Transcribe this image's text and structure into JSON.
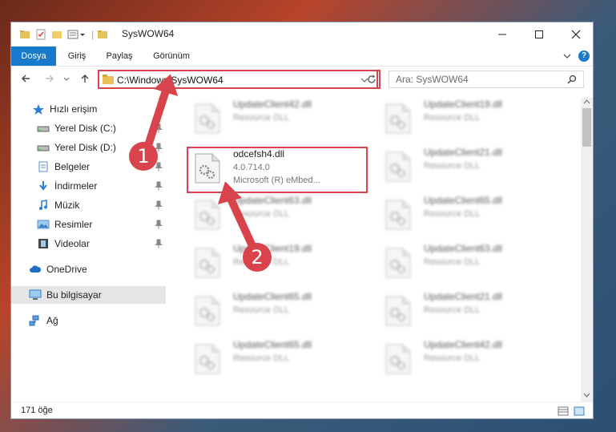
{
  "window": {
    "title": "SysWOW64"
  },
  "ribbon": {
    "tabs": [
      "Dosya",
      "Giriş",
      "Paylaş",
      "Görünüm"
    ]
  },
  "address": {
    "path": "C:\\Windows\\SysWOW64"
  },
  "search": {
    "placeholder": "Ara: SysWOW64"
  },
  "sidebar": {
    "items": [
      {
        "label": "Hızlı erişim",
        "icon": "star-icon"
      },
      {
        "label": "Yerel Disk (C:)",
        "icon": "drive-icon",
        "pinned": true
      },
      {
        "label": "Yerel Disk (D:)",
        "icon": "drive-icon",
        "pinned": true
      },
      {
        "label": "Belgeler",
        "icon": "documents-icon",
        "pinned": true
      },
      {
        "label": "İndirmeler",
        "icon": "download-icon",
        "pinned": true
      },
      {
        "label": "Müzik",
        "icon": "music-icon",
        "pinned": true
      },
      {
        "label": "Resimler",
        "icon": "pictures-icon",
        "pinned": true
      },
      {
        "label": "Videolar",
        "icon": "videos-icon",
        "pinned": true
      },
      {
        "label": "OneDrive",
        "icon": "cloud-icon"
      },
      {
        "label": "Bu bilgisayar",
        "icon": "computer-icon",
        "selected": true
      },
      {
        "label": "Ağ",
        "icon": "network-icon"
      }
    ]
  },
  "files": {
    "highlighted": {
      "name": "odcefsh4.dll",
      "version": "4.0.714.0",
      "company": "Microsoft (R) eMbed..."
    },
    "left_column": [
      {
        "name": "UpdateClient42.dll",
        "desc": "Resource DLL"
      },
      {
        "name": "UpdateClient63.dll",
        "desc": "Resource DLL"
      },
      {
        "name": "UpdateClient19.dll",
        "desc": "Resource DLL"
      },
      {
        "name": "UpdateClient65.dll",
        "desc": "Resource DLL"
      },
      {
        "name": "UpdateClient65.dll",
        "desc": "Resource DLL"
      }
    ],
    "right_column": [
      {
        "name": "UpdateClient19.dll",
        "desc": "Resource DLL"
      },
      {
        "name": "UpdateClient21.dll",
        "desc": "Resource DLL"
      },
      {
        "name": "UpdateClient65.dll",
        "desc": "Resource DLL"
      },
      {
        "name": "UpdateClient63.dll",
        "desc": "Resource DLL"
      },
      {
        "name": "UpdateClient21.dll",
        "desc": "Resource DLL"
      },
      {
        "name": "UpdateClient42.dll",
        "desc": "Resource DLL"
      }
    ]
  },
  "status": {
    "count": "171 öğe"
  },
  "callouts": [
    "1",
    "2"
  ],
  "colors": {
    "accent": "#1979ca",
    "highlight": "#d9434b"
  }
}
